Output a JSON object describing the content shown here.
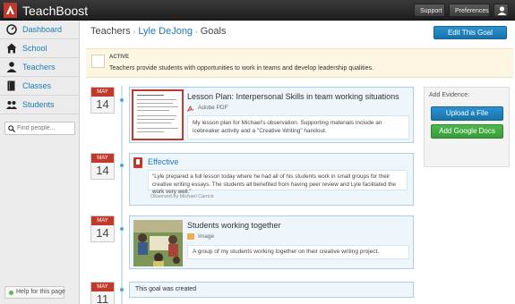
{
  "app": {
    "brand": "TeachBoost"
  },
  "topbar": {
    "support_label": "Support",
    "preferences_label": "Preferences",
    "user_icon": "user-icon"
  },
  "sidebar": {
    "items": [
      {
        "label": "Dashboard",
        "icon": "dashboard-icon"
      },
      {
        "label": "School",
        "icon": "school-icon"
      },
      {
        "label": "Teachers",
        "icon": "teacher-icon"
      },
      {
        "label": "Classes",
        "icon": "classes-icon"
      },
      {
        "label": "Students",
        "icon": "students-icon"
      }
    ],
    "search": {
      "placeholder": "Find people..."
    },
    "help_label": "Help for this page"
  },
  "breadcrumb": {
    "root": "Teachers",
    "teacher": "Lyle DeJong",
    "current": "Goals"
  },
  "header": {
    "edit_label": "Edit This Goal"
  },
  "goal": {
    "status": "ACTIVE",
    "text": "Teachers provide students with opportunities to work in teams and develop leadership qualities."
  },
  "evidence_panel": {
    "title": "Add Evidence:",
    "upload_label": "Upload a File",
    "gdocs_label": "Add Google Docs"
  },
  "timeline": [
    {
      "month": "MAY",
      "day": "14",
      "title": "Lesson Plan: Interpersonal Skills in team working situations",
      "file_type": "Adobe PDF",
      "description": "My lesson plan for Michael's observation. Supporting materials include an icebreaker activity and a \"Creative Writing\" handout."
    },
    {
      "month": "MAY",
      "day": "14",
      "title": "Effective",
      "quote": "\"Lyle prepared a full lesson today where he had all of his students work in small groups for their creative writing essays. The students all benefited from having peer review and Lyle facilitated the work very well.\"",
      "observer": "Observed by Michael Carrick"
    },
    {
      "month": "MAY",
      "day": "14",
      "title": "Students working together",
      "file_type": "Image",
      "description": "A group of my students working together on their creative writing project."
    },
    {
      "month": "MAY",
      "day": "11",
      "text": "This goal was created"
    }
  ]
}
